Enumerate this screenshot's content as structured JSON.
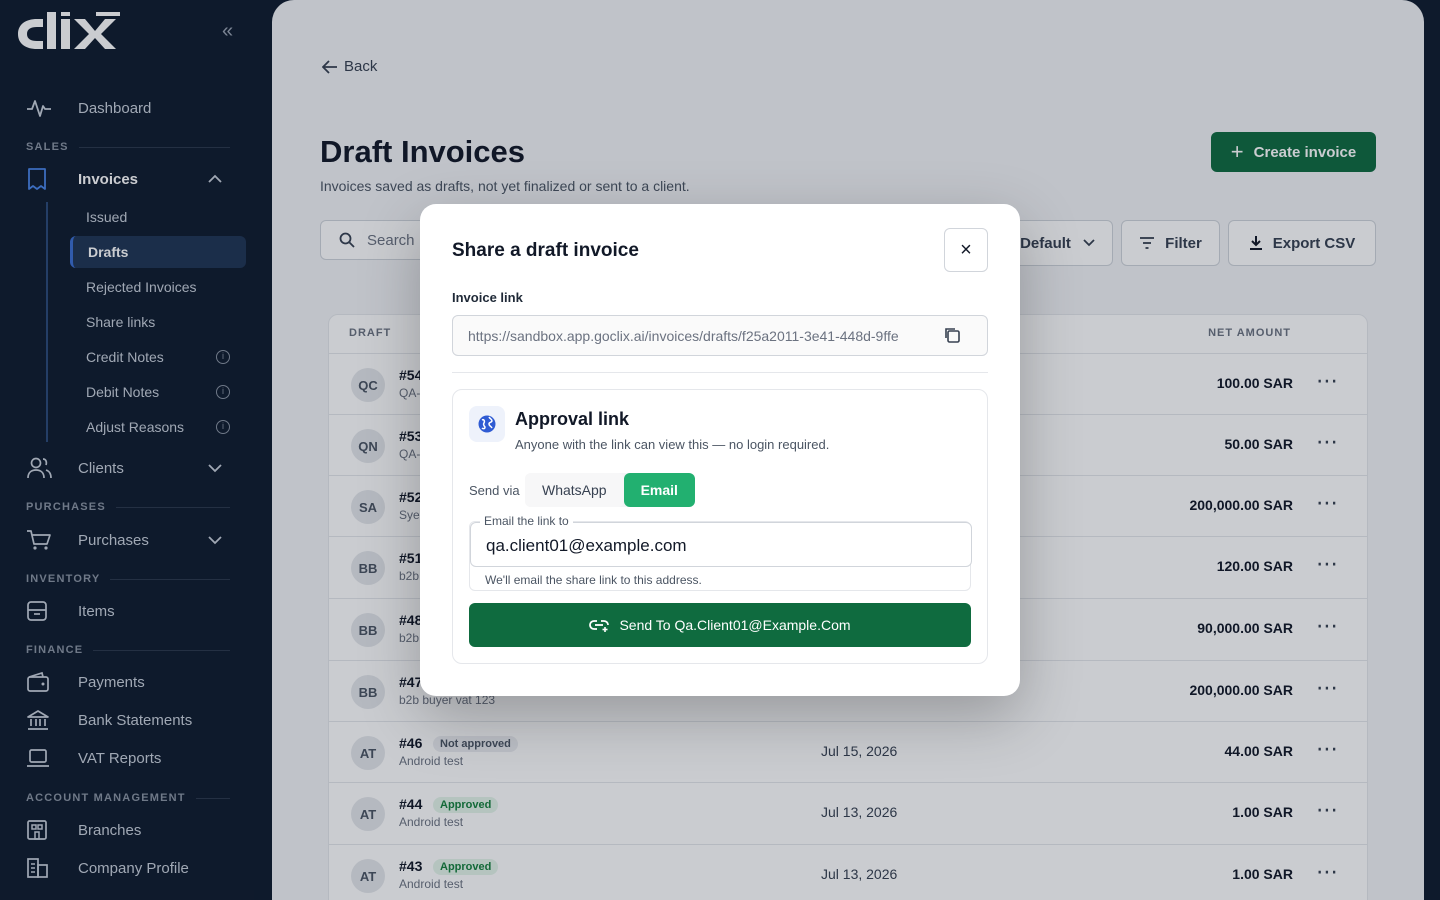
{
  "sidebar": {
    "logo": "CLIX",
    "collapse_icon": "«",
    "dashboard": "Dashboard",
    "sections": {
      "sales": "SALES",
      "purchases": "PURCHASES",
      "inventory": "INVENTORY",
      "finance": "FINANCE",
      "account": "ACCOUNT MANAGEMENT"
    },
    "invoices": "Invoices",
    "invoice_sub": [
      "Issued",
      "Drafts",
      "Rejected Invoices",
      "Share links",
      "Credit Notes",
      "Debit Notes",
      "Adjust Reasons"
    ],
    "clients": "Clients",
    "purchases": "Purchases",
    "items": "Items",
    "payments": "Payments",
    "bank_statements": "Bank Statements",
    "vat_reports": "VAT Reports",
    "branches": "Branches",
    "company_profile": "Company Profile"
  },
  "page": {
    "back": "Back",
    "title": "Draft Invoices",
    "subtitle": "Invoices saved as drafts, not yet finalized or sent to a client.",
    "create_label": "Create invoice",
    "search_placeholder": "Search",
    "sort_label": "Default",
    "filter_label": "Filter",
    "export_label": "Export CSV"
  },
  "table": {
    "col_draft": "DRAFT",
    "col_net": "NET AMOUNT",
    "rows": [
      {
        "initials": "QC",
        "no": "#54",
        "badge": "",
        "client": "QA-",
        "date": "",
        "amount": "100.00 SAR"
      },
      {
        "initials": "QN",
        "no": "#53",
        "badge": "",
        "client": "QA-",
        "date": "",
        "amount": "50.00 SAR"
      },
      {
        "initials": "SA",
        "no": "#52",
        "badge": "",
        "client": "Sye",
        "date": "",
        "amount": "200,000.00 SAR"
      },
      {
        "initials": "BB",
        "no": "#51",
        "badge": "",
        "client": "b2b",
        "date": "",
        "amount": "120.00 SAR"
      },
      {
        "initials": "BB",
        "no": "#48",
        "badge": "",
        "client": "b2b",
        "date": "",
        "amount": "90,000.00 SAR"
      },
      {
        "initials": "BB",
        "no": "#47",
        "badge": "",
        "client": "b2b buyer vat 123",
        "date": "",
        "amount": "200,000.00 SAR"
      },
      {
        "initials": "AT",
        "no": "#46",
        "badge": "Not approved",
        "client": "Android test",
        "date": "Jul 15, 2026",
        "amount": "44.00 SAR"
      },
      {
        "initials": "AT",
        "no": "#44",
        "badge": "Approved",
        "client": "Android test",
        "date": "Jul 13, 2026",
        "amount": "1.00 SAR"
      },
      {
        "initials": "AT",
        "no": "#43",
        "badge": "Approved",
        "client": "Android test",
        "date": "Jul 13, 2026",
        "amount": "1.00 SAR"
      }
    ]
  },
  "modal": {
    "title": "Share a draft invoice",
    "close_icon": "×",
    "link_label": "Invoice link",
    "link_value": "https://sandbox.app.goclix.ai/invoices/drafts/f25a2011-3e41-448d-9ffe",
    "approval_title": "Approval link",
    "approval_desc": "Anyone with the link can view this — no login required.",
    "send_via": "Send via",
    "channel_whatsapp": "WhatsApp",
    "channel_email": "Email",
    "email_label": "Email the link to",
    "email_value": "qa.client01@example.com",
    "email_helper": "We'll email the share link to this address.",
    "send_label": "Send To Qa.Client01@Example.Com"
  },
  "colors": {
    "sidebar_bg": "#0f1b2d",
    "primary_green": "#0f6b3f",
    "accent_green": "#22b070"
  }
}
